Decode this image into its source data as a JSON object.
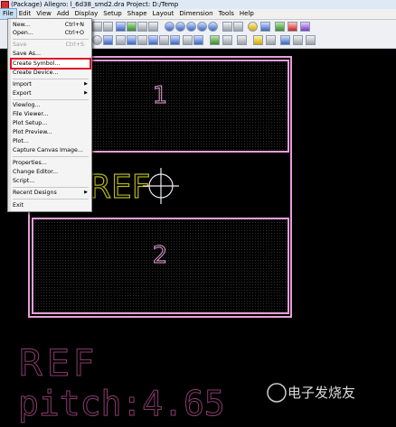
{
  "title_bar": {
    "text": "(Package) Allegro: l_6d38_smd2.dra  Project: D:/Temp"
  },
  "menu_bar": {
    "items": [
      "File",
      "Edit",
      "View",
      "Add",
      "Display",
      "Setup",
      "Shape",
      "Layout",
      "Dimension",
      "Tools",
      "Help"
    ],
    "active": "File"
  },
  "file_menu": {
    "items": [
      {
        "label": "New...",
        "shortcut": "Ctrl+N",
        "disabled": false
      },
      {
        "label": "Open...",
        "shortcut": "Ctrl+O",
        "disabled": false
      },
      {
        "label": "Save",
        "shortcut": "Ctrl+S",
        "disabled": true
      },
      {
        "label": "Save As...",
        "shortcut": "",
        "disabled": false
      },
      {
        "label": "Create Symbol...",
        "shortcut": "",
        "disabled": false,
        "highlighted": true
      },
      {
        "label": "Create Device...",
        "shortcut": "",
        "disabled": false
      },
      {
        "label": "Import",
        "submenu": true
      },
      {
        "label": "Export",
        "submenu": true
      },
      {
        "label": "Viewlog...",
        "shortcut": ""
      },
      {
        "label": "File Viewer...",
        "shortcut": ""
      },
      {
        "label": "Plot Setup...",
        "shortcut": ""
      },
      {
        "label": "Plot Preview...",
        "shortcut": ""
      },
      {
        "label": "Plot...",
        "shortcut": ""
      },
      {
        "label": "Capture Canvas Image...",
        "shortcut": ""
      },
      {
        "label": "Properties...",
        "shortcut": ""
      },
      {
        "label": "Change Editor...",
        "shortcut": ""
      },
      {
        "label": "Script...",
        "shortcut": ""
      },
      {
        "label": "Recent Designs",
        "submenu": true
      },
      {
        "label": "Exit",
        "shortcut": ""
      }
    ]
  },
  "canvas": {
    "pad_labels": [
      "1",
      "2"
    ],
    "ref_label": "REF",
    "bottom_text_1": "REF",
    "bottom_text_2": "pitch:4.65",
    "watermark": "电子发烧友"
  },
  "colors": {
    "pad_outline": "#e79fd8",
    "silkscreen": "#b6b61e",
    "origin_cross": "#f5e6f5",
    "bottom_text": "#8a3c6e",
    "menu_highlight": "#e0142a"
  }
}
